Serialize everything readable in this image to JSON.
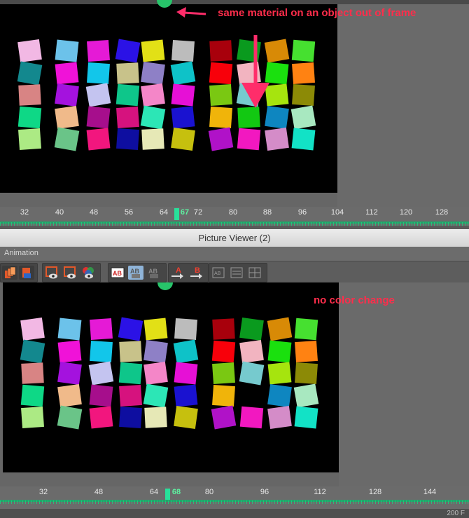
{
  "annotations": {
    "top": "same material on an object out of frame",
    "bottom": "no color change"
  },
  "timeline_top": {
    "ticks": [
      "32",
      "40",
      "48",
      "56",
      "64",
      "67",
      "72",
      "80",
      "88",
      "96",
      "104",
      "112",
      "120",
      "128"
    ],
    "current_frame": "67"
  },
  "picture_viewer": {
    "title": "Picture Viewer (2)",
    "menu": "Animation",
    "toolbar_icons": [
      "film-stack-icon",
      "film-save-icon",
      "eye-frame-icon",
      "eye-frame-alt-icon",
      "eye-rgb-icon",
      "ab-compare-icon",
      "ab-split-icon",
      "ab-disabled-icon",
      "a-arrow-icon",
      "b-arrow-icon",
      "ab-grid-icon",
      "ab-list-icon",
      "ab-grid-alt-icon"
    ]
  },
  "timeline_bottom": {
    "ticks": [
      "32",
      "48",
      "64",
      "68",
      "80",
      "96",
      "112",
      "128",
      "144"
    ],
    "current_frame": "68"
  },
  "status": {
    "frames": "200 F"
  },
  "colors": {
    "accent_annotation": "#ff2d4b",
    "playhead": "#28e09a",
    "canvas": "#000000"
  },
  "swatches_top": [
    [
      "#f2b8e4",
      "#6cc2ea",
      "#e51ad6",
      "#2b12e6",
      "#e2e016",
      "#bcbcbc",
      "#a8000c",
      "#0a9a1e",
      "#d88a06",
      "#46e030"
    ],
    [
      "#13888e",
      "#f012d8",
      "#12c6ea",
      "#c8c28a",
      "#8e80c6",
      "#0ec2c8",
      "#f8000a",
      "#f2b4c0",
      "#1ae00e",
      "#ff8212"
    ],
    [
      "#d88484",
      "#a412de",
      "#c4c4f0",
      "#0ec68a",
      "#f486c8",
      "#e610d6",
      "#7ac812",
      "#76cace",
      "#a6e40e",
      "#8c8a06"
    ],
    [
      "#0ed886",
      "#f0ba8a",
      "#a60e8c",
      "#d6127e",
      "#2ce6b6",
      "#1a12d0",
      "#f0b40a",
      "#12c812",
      "#0e86c0",
      "#a8e8c0"
    ],
    [
      "#acea84",
      "#6ac488",
      "#f2167e",
      "#0e0ea0",
      "#e6e8b6",
      "#c6c00e",
      "#b012c8",
      "#f218c0",
      "#d48cc8",
      "#12e2c6"
    ]
  ],
  "swatches_bottom": [
    [
      "#f2b8e4",
      "#6cc2ea",
      "#e51ad6",
      "#2b12e6",
      "#e2e016",
      "#bcbcbc",
      "#a8000c",
      "#0a9a1e",
      "#d88a06",
      "#46e030"
    ],
    [
      "#13888e",
      "#f012d8",
      "#12c6ea",
      "#c8c28a",
      "#8e80c6",
      "#0ec2c8",
      "#f8000a",
      "#f2b4c0",
      "#1ae00e",
      "#ff8212"
    ],
    [
      "#d88484",
      "#a412de",
      "#c4c4f0",
      "#0ec68a",
      "#f486c8",
      "#e610d6",
      "#7ac812",
      "#76cace",
      "#a6e40e",
      "#8c8a06"
    ],
    [
      "#0ed886",
      "#f0ba8a",
      "#a60e8c",
      "#d6127e",
      "#2ce6b6",
      "#1a12d0",
      "#f0b40a",
      null,
      "#0e86c0",
      "#a8e8c0"
    ],
    [
      "#acea84",
      "#6ac488",
      "#f2167e",
      "#0e0ea0",
      "#e6e8b6",
      "#c6c00e",
      "#b012c8",
      "#f218c0",
      "#d48cc8",
      "#12e2c6"
    ]
  ]
}
